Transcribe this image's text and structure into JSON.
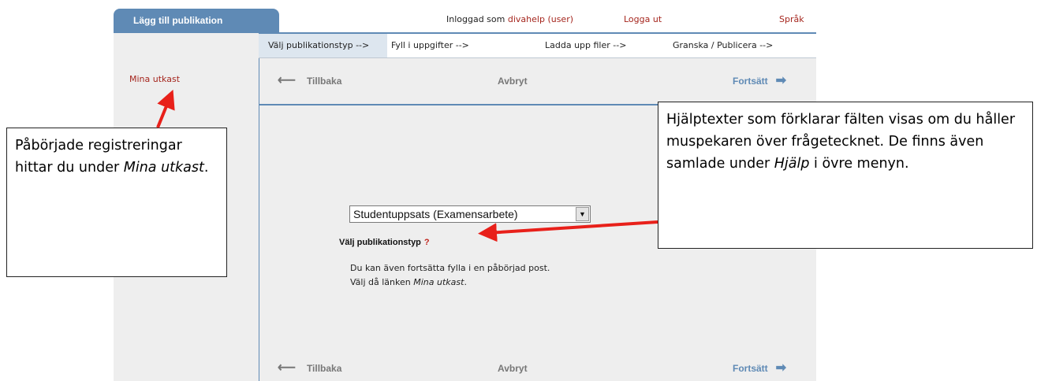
{
  "sidebar": {
    "tab_label": "Lägg till publikation",
    "drafts_link": "Mina utkast"
  },
  "header": {
    "logged_in_prefix": "Inloggad som",
    "user": "divahelp (user)",
    "logout": "Logga ut",
    "language": "Språk"
  },
  "steps": [
    {
      "label": "Välj publikationstyp -->",
      "active": true
    },
    {
      "label": "Fyll i uppgifter -->",
      "active": false
    },
    {
      "label": "Ladda upp filer -->",
      "active": false
    },
    {
      "label": "Granska / Publicera -->",
      "active": false
    }
  ],
  "nav": {
    "back": "Tillbaka",
    "cancel": "Avbryt",
    "forward": "Fortsätt"
  },
  "form": {
    "pubtype_label": "Välj publikationstyp",
    "help_mark": "?",
    "pubtype_value": "Studentuppsats (Examensarbete)",
    "info_line1": "Du kan även fortsätta fylla i en påbörjad post.",
    "info_line2_prefix": "Välj då länken ",
    "info_line2_link": "Mina utkast",
    "info_line2_suffix": "."
  },
  "callouts": {
    "left": {
      "text_a": "Påbörjade registreringar hittar du under ",
      "italic": "Mina utkast",
      "text_b": "."
    },
    "right": {
      "text_a": "Hjälptexter som förklarar fälten visas om du håller muspekaren över frågetecknet. De finns även samlade under ",
      "italic": "Hjälp",
      "text_b": " i övre menyn."
    }
  },
  "icons": {
    "back": "arrow-left-icon",
    "forward": "arrow-right-icon",
    "dropdown": "chevron-down-icon"
  },
  "colors": {
    "accent_blue": "#5f8ab5",
    "link_red": "#a5261e",
    "callout_arrow": "#e8201a"
  }
}
